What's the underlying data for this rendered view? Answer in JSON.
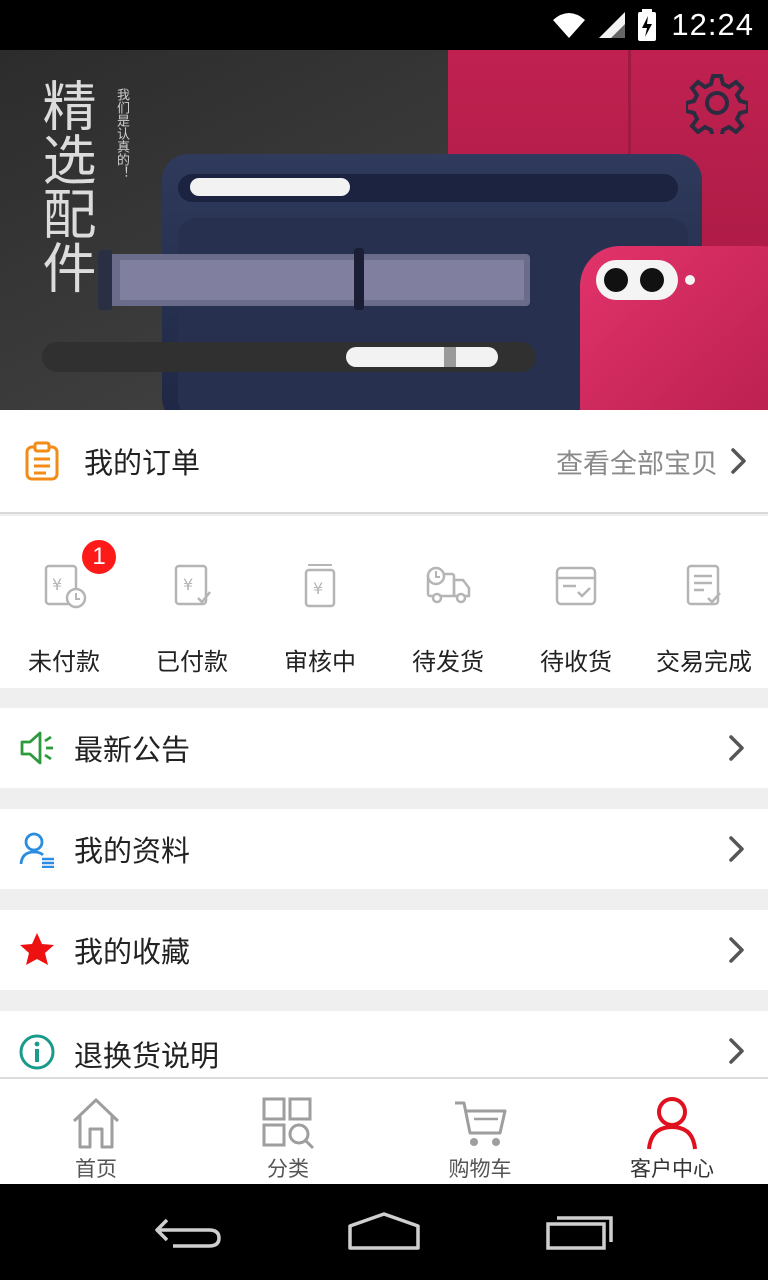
{
  "status_bar": {
    "time": "12:24"
  },
  "banner": {
    "headline": "精选配件",
    "tagline": "我们是认真的！"
  },
  "orders": {
    "title": "我的订单",
    "view_all": "查看全部宝贝",
    "statuses": [
      {
        "label": "未付款",
        "icon": "unpaid-icon",
        "badge": "1"
      },
      {
        "label": "已付款",
        "icon": "paid-icon"
      },
      {
        "label": "审核中",
        "icon": "reviewing-icon"
      },
      {
        "label": "待发货",
        "icon": "shipping-truck-icon"
      },
      {
        "label": "待收货",
        "icon": "receive-box-icon"
      },
      {
        "label": "交易完成",
        "icon": "completed-doc-icon"
      }
    ]
  },
  "menu": [
    {
      "label": "最新公告",
      "icon": "speaker-icon",
      "color": "#2e9a3c"
    },
    {
      "label": "我的资料",
      "icon": "profile-icon",
      "color": "#2a8de0"
    },
    {
      "label": "我的收藏",
      "icon": "star-icon",
      "color": "#ee1111"
    },
    {
      "label": "退换货说明",
      "icon": "info-icon",
      "color": "#1a9a8a"
    }
  ],
  "bottom_nav": [
    {
      "label": "首页",
      "icon": "home-icon"
    },
    {
      "label": "分类",
      "icon": "category-icon"
    },
    {
      "label": "购物车",
      "icon": "cart-icon"
    },
    {
      "label": "客户中心",
      "icon": "user-icon",
      "active": true
    }
  ],
  "colors": {
    "accent": "#e0101f",
    "badge": "#ff1a1a",
    "icon_gray": "#b5b5b5"
  }
}
